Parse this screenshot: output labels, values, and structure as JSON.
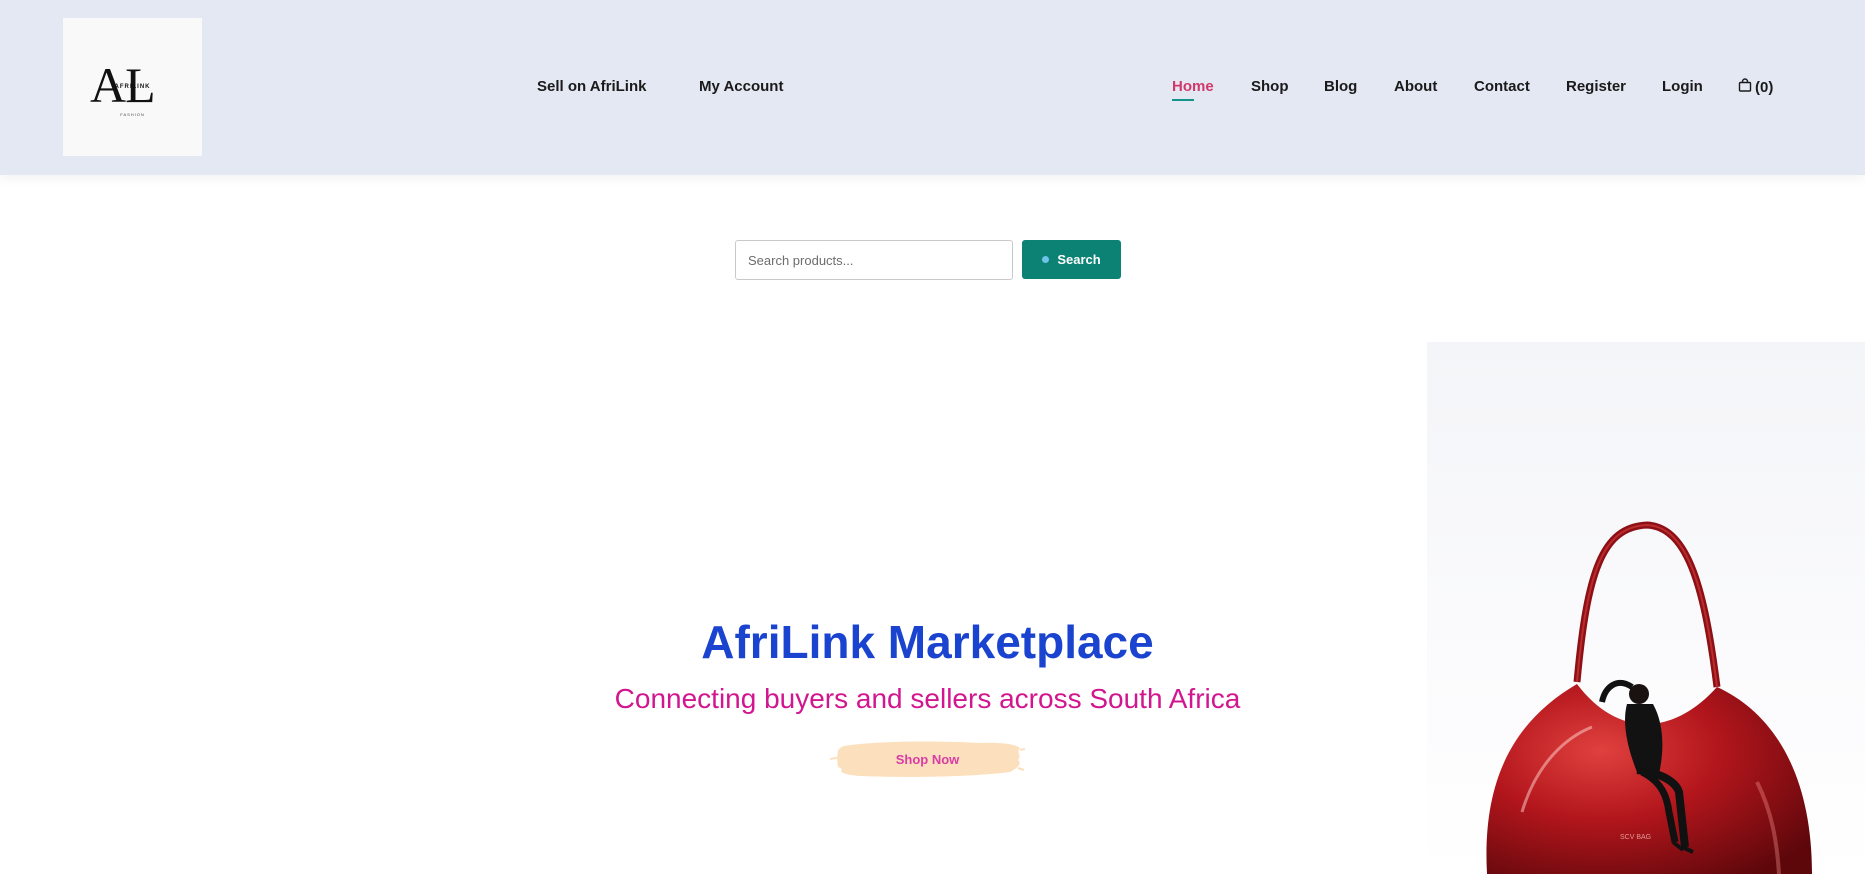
{
  "header": {
    "logo": {
      "monogram": "AL",
      "brand": "AFRILINK",
      "tagline": "FASHION"
    },
    "left_nav": [
      {
        "label": "Sell on AfriLink"
      },
      {
        "label": "My Account"
      }
    ],
    "main_nav": [
      {
        "label": "Home",
        "active": true
      },
      {
        "label": "Shop"
      },
      {
        "label": "Blog"
      },
      {
        "label": "About"
      },
      {
        "label": "Contact"
      },
      {
        "label": "Register"
      },
      {
        "label": "Login"
      }
    ],
    "cart": {
      "icon": "shopping-bag-icon",
      "count_label": "(0)"
    }
  },
  "search": {
    "placeholder": "Search products...",
    "button_label": "Search",
    "button_color": "#0c8275"
  },
  "hero": {
    "title": "AfriLink Marketplace",
    "subtitle": "Connecting buyers and sellers across South Africa",
    "cta_label": "Shop Now",
    "title_color": "#1a43cf",
    "subtitle_color": "#d1168f",
    "image": {
      "subject": "red handbag with seated figure",
      "bag_text": "SCV BAG"
    }
  },
  "colors": {
    "header_bg": "#e4e8f3",
    "nav_active": "#d2396b",
    "nav_active_underline": "#139389",
    "cta_brush": "#fce0bd"
  }
}
